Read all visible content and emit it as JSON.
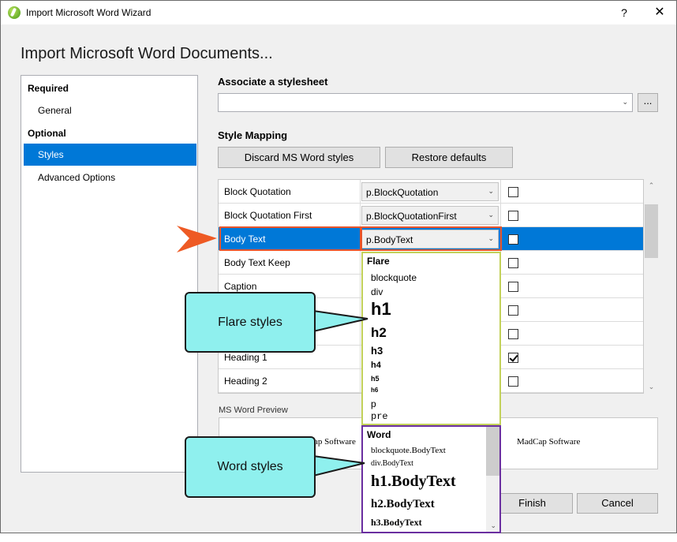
{
  "window": {
    "title": "Import Microsoft Word Wizard",
    "help": "?",
    "close": "✕"
  },
  "heading": "Import Microsoft Word Documents...",
  "nav": {
    "required": "Required",
    "general": "General",
    "optional": "Optional",
    "styles": "Styles",
    "advanced": "Advanced Options"
  },
  "stylesheet": {
    "label": "Associate a stylesheet",
    "value": "",
    "browse": "..."
  },
  "mapping": {
    "label": "Style Mapping",
    "discard": "Discard MS Word styles",
    "restore": "Restore defaults",
    "rows": [
      {
        "name": "Block Quotation",
        "style": "p.BlockQuotation",
        "checked": false
      },
      {
        "name": "Block Quotation First",
        "style": "p.BlockQuotationFirst",
        "checked": false
      },
      {
        "name": "Body Text",
        "style": "p.BodyText",
        "checked": false
      },
      {
        "name": "Body Text Keep",
        "style": "",
        "checked": false
      },
      {
        "name": "Caption",
        "style": "",
        "checked": false
      },
      {
        "name": "",
        "style": "",
        "checked": false
      },
      {
        "name": "",
        "style": "",
        "checked": false
      },
      {
        "name": "Heading 1",
        "style": "",
        "checked": true
      },
      {
        "name": "Heading 2",
        "style": "",
        "checked": false
      }
    ]
  },
  "preview": {
    "label": "MS Word Preview",
    "left_text": "ap Software",
    "right_text": "MadCap Software"
  },
  "flare_list": {
    "header": "Flare",
    "items": [
      "blockquote",
      "div",
      "h1",
      "h2",
      "h3",
      "h4",
      "h5",
      "h6",
      "p",
      "pre"
    ]
  },
  "word_list": {
    "header": "Word",
    "items": [
      "blockquote.BodyText",
      "div.BodyText",
      "h1.BodyText",
      "h2.BodyText",
      "h3.BodyText"
    ]
  },
  "callouts": {
    "flare": "Flare styles",
    "word": "Word styles"
  },
  "footer": {
    "finish": "Finish",
    "cancel": "Cancel"
  },
  "colors": {
    "accent": "#0078d7",
    "highlight": "#e8542a",
    "flare_border": "#c2d15a",
    "word_border": "#6a2ea0",
    "callout": "#8ff0ee"
  }
}
